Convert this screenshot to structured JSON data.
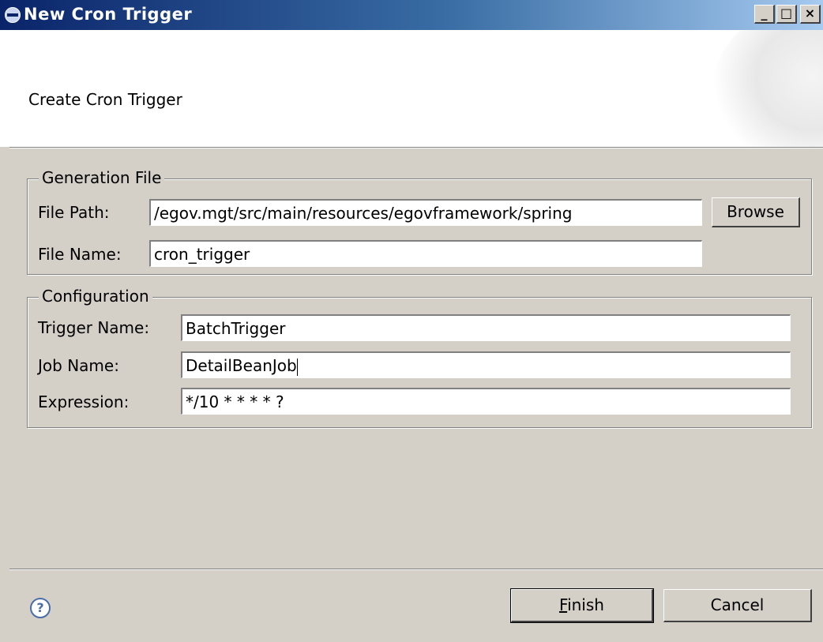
{
  "window": {
    "title": "New Cron Trigger",
    "controls": {
      "minimize": "_",
      "maximize": "□",
      "close": "×"
    }
  },
  "header": {
    "title": "Create Cron Trigger"
  },
  "generation_file": {
    "legend": "Generation File",
    "file_path_label": "File Path:",
    "file_path_value": "/egov.mgt/src/main/resources/egovframework/spring",
    "browse_label": "Browse",
    "file_name_label": "File Name:",
    "file_name_value": "cron_trigger"
  },
  "configuration": {
    "legend": "Configuration",
    "trigger_name_label": "Trigger Name:",
    "trigger_name_value": "BatchTrigger",
    "job_name_label": "Job Name:",
    "job_name_value": "DetailBeanJob",
    "expression_label": "Expression:",
    "expression_value": "*/10 * * * * ?"
  },
  "footer": {
    "help_icon": "?",
    "finish_first": "F",
    "finish_rest": "inish",
    "cancel_label": "Cancel"
  }
}
